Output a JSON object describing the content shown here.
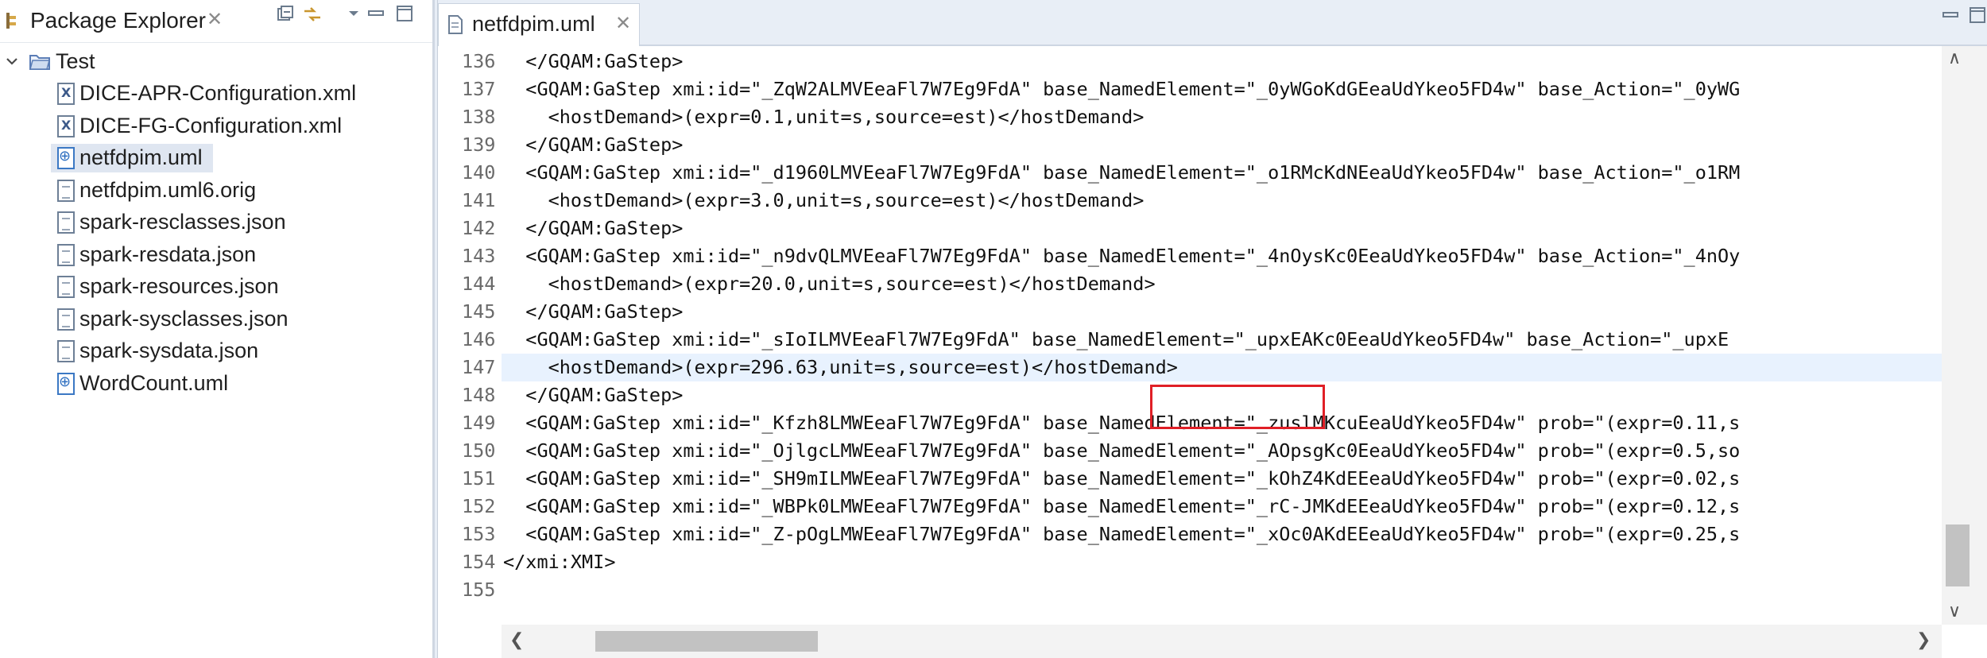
{
  "explorer": {
    "title": "Package Explorer",
    "close": "✕",
    "project": "Test",
    "files": [
      {
        "name": "DICE-APR-Configuration.xml",
        "type": "xml"
      },
      {
        "name": "DICE-FG-Configuration.xml",
        "type": "xml"
      },
      {
        "name": "netfdpim.uml",
        "type": "uml"
      },
      {
        "name": "netfdpim.uml6.orig",
        "type": "txt"
      },
      {
        "name": "spark-resclasses.json",
        "type": "txt"
      },
      {
        "name": "spark-resdata.json",
        "type": "txt"
      },
      {
        "name": "spark-resources.json",
        "type": "txt"
      },
      {
        "name": "spark-sysclasses.json",
        "type": "txt"
      },
      {
        "name": "spark-sysdata.json",
        "type": "txt"
      },
      {
        "name": "WordCount.uml",
        "type": "uml"
      }
    ],
    "selected_index": 2
  },
  "editor": {
    "tab_label": "netfdpim.uml",
    "tab_close": "✕",
    "current_line": 147,
    "lines": [
      {
        "no": "136",
        "text": "  </GQAM:GaStep>"
      },
      {
        "no": "137",
        "text": "  <GQAM:GaStep xmi:id=\"_ZqW2ALMVEeaFl7W7Eg9FdA\" base_NamedElement=\"_0yWGoKdGEeaUdYkeo5FD4w\" base_Action=\"_0yWG"
      },
      {
        "no": "138",
        "text": "    <hostDemand>(expr=0.1,unit=s,source=est)</hostDemand>"
      },
      {
        "no": "139",
        "text": "  </GQAM:GaStep>"
      },
      {
        "no": "140",
        "text": "  <GQAM:GaStep xmi:id=\"_d1960LMVEeaFl7W7Eg9FdA\" base_NamedElement=\"_o1RMcKdNEeaUdYkeo5FD4w\" base_Action=\"_o1RM"
      },
      {
        "no": "141",
        "text": "    <hostDemand>(expr=3.0,unit=s,source=est)</hostDemand>"
      },
      {
        "no": "142",
        "text": "  </GQAM:GaStep>"
      },
      {
        "no": "143",
        "text": "  <GQAM:GaStep xmi:id=\"_n9dvQLMVEeaFl7W7Eg9FdA\" base_NamedElement=\"_4nOysKc0EeaUdYkeo5FD4w\" base_Action=\"_4nOy"
      },
      {
        "no": "144",
        "text": "    <hostDemand>(expr=20.0,unit=s,source=est)</hostDemand>"
      },
      {
        "no": "145",
        "text": "  </GQAM:GaStep>"
      },
      {
        "no": "146",
        "text": "  <GQAM:GaStep xmi:id=\"_sIoILMVEeaFl7W7Eg9FdA\" base_NamedElement=\"_upxEAKc0EeaUdYkeo5FD4w\" base_Action=\"_upxE"
      },
      {
        "no": "147",
        "text": "    <hostDemand>(expr=296.63,unit=s,source=est)</hostDemand>"
      },
      {
        "no": "148",
        "text": "  </GQAM:GaStep>"
      },
      {
        "no": "149",
        "text": "  <GQAM:GaStep xmi:id=\"_Kfzh8LMWEeaFl7W7Eg9FdA\" base_NamedElement=\"_zuslMKcuEeaUdYkeo5FD4w\" prob=\"(expr=0.11,s"
      },
      {
        "no": "150",
        "text": "  <GQAM:GaStep xmi:id=\"_OjlgcLMWEeaFl7W7Eg9FdA\" base_NamedElement=\"_AOpsgKc0EeaUdYkeo5FD4w\" prob=\"(expr=0.5,so"
      },
      {
        "no": "151",
        "text": "  <GQAM:GaStep xmi:id=\"_SH9mILMWEeaFl7W7Eg9FdA\" base_NamedElement=\"_kOhZ4KdEEeaUdYkeo5FD4w\" prob=\"(expr=0.02,s"
      },
      {
        "no": "152",
        "text": "  <GQAM:GaStep xmi:id=\"_WBPk0LMWEeaFl7W7Eg9FdA\" base_NamedElement=\"_rC-JMKdEEeaUdYkeo5FD4w\" prob=\"(expr=0.12,s"
      },
      {
        "no": "153",
        "text": "  <GQAM:GaStep xmi:id=\"_Z-pOgLMWEeaFl7W7Eg9FdA\" base_NamedElement=\"_xOc0AKdEEeaUdYkeo5FD4w\" prob=\"(expr=0.25,s"
      },
      {
        "no": "154",
        "text": "</xmi:XMI>"
      },
      {
        "no": "155",
        "text": ""
      }
    ]
  },
  "colors": {
    "highlight_box": "#e01f26",
    "current_line_bg": "#e8f2fe",
    "selection_bg": "#dfe6f1"
  }
}
